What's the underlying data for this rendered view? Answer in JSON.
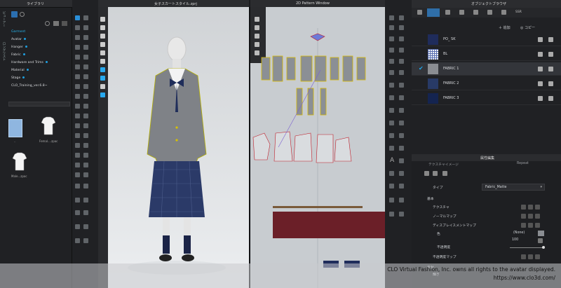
{
  "library": {
    "title": "ライブラリ",
    "vtab1": "ビューアー",
    "vtab2": "ロングリスト",
    "items": [
      {
        "label": "Garment",
        "active": true
      },
      {
        "label": "Avatar"
      },
      {
        "label": "Hanger"
      },
      {
        "label": "Fabric"
      },
      {
        "label": "Hardware and Trims"
      },
      {
        "label": "Material"
      },
      {
        "label": "Stage"
      },
      {
        "label": "CLO_Training_ver.6.8~"
      }
    ],
    "files": [
      {
        "label": ".."
      },
      {
        "label": "Femal....zpac"
      },
      {
        "label": "Male...zpac"
      }
    ]
  },
  "view3d": {
    "title": "女子スカートスタイル.zprj"
  },
  "view2d": {
    "title": "2D Pattern Window"
  },
  "object_browser": {
    "title": "オブジェクトブラウザ",
    "tab_label": "SSR",
    "add_label": "＋ 追加",
    "copy_label": "◎ コピー",
    "fabrics": [
      {
        "name": "PO_ SK",
        "color": "#1f2c5b"
      },
      {
        "name": "BL",
        "color": "#e9ecf0"
      },
      {
        "name": "FABRIC 1",
        "color": "#8a8d92",
        "selected": true
      },
      {
        "name": "FABRIC 2",
        "color": "#283a66"
      },
      {
        "name": "FABRIC 3",
        "color": "#142450"
      }
    ]
  },
  "property_editor": {
    "title": "属性編集",
    "top_row": "テクスチャイメージ",
    "top_value": "Repeat",
    "type_label": "タイプ",
    "type_value": "Fabric_Matte",
    "sections": [
      "基本",
      "テクスチャ",
      "ノーマルマップ",
      "ディスプレイスメントマップ"
    ],
    "color_label": "色",
    "color_value": "(None)",
    "opacity_label": "不透明度",
    "opacity_value": "100",
    "opacity_map": "不透明度マップ",
    "reflection": "反射",
    "glow": "輝き"
  },
  "watermark": {
    "line1": "CLO Virtual Fashion, Inc. owns all rights to the avatar displayed.",
    "line2": "https://www.clo3d.com/"
  }
}
